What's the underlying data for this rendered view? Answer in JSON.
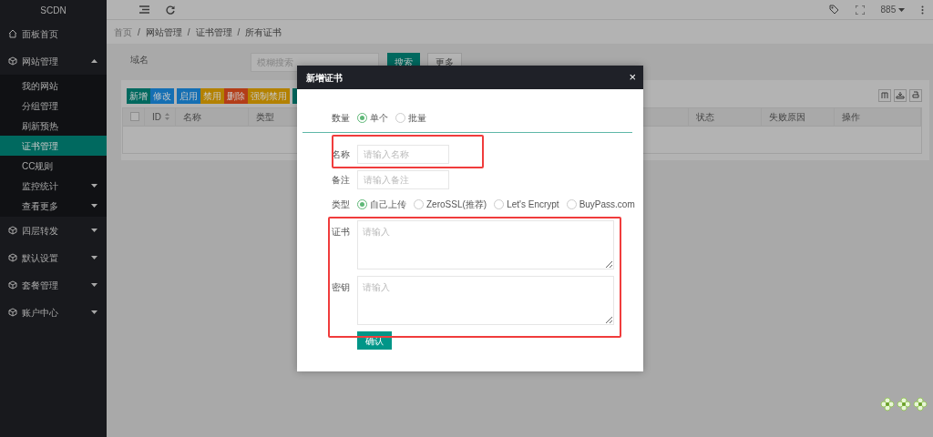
{
  "sidebar": {
    "logo": "SCDN",
    "items": [
      {
        "kind": "home",
        "label": "面板首页"
      },
      {
        "kind": "menu",
        "label": "网站管理",
        "expanded": true,
        "children": [
          {
            "kind": "link",
            "label": "我的网站",
            "selected": false
          },
          {
            "kind": "link",
            "label": "分组管理",
            "selected": false
          },
          {
            "kind": "link",
            "label": "刷新预热",
            "selected": false
          },
          {
            "kind": "link",
            "label": "证书管理",
            "selected": true
          },
          {
            "kind": "link",
            "label": "CC规则",
            "selected": false
          },
          {
            "kind": "menu",
            "label": "监控统计",
            "selected": false,
            "expanded": false
          },
          {
            "kind": "menu",
            "label": "查看更多",
            "selected": false,
            "expanded": false
          }
        ]
      },
      {
        "kind": "menu",
        "label": "四层转发",
        "expanded": false
      },
      {
        "kind": "menu",
        "label": "默认设置",
        "expanded": false
      },
      {
        "kind": "menu",
        "label": "套餐管理",
        "expanded": false
      },
      {
        "kind": "menu",
        "label": "账户中心",
        "expanded": false
      }
    ]
  },
  "header": {
    "user": "885"
  },
  "breadcrumb": {
    "separator": "/",
    "items": [
      "首页",
      "网站管理",
      "证书管理",
      "所有证书"
    ]
  },
  "filter": {
    "label": "域名",
    "placeholder": "模糊搜索",
    "search_button": "搜索",
    "more_button": "更多"
  },
  "toolbar": [
    {
      "buttons": [
        {
          "label": "新增",
          "color": "#00695f"
        },
        {
          "label": "修改",
          "color": "#156fb3"
        }
      ]
    },
    {
      "buttons": [
        {
          "label": "启用",
          "color": "#156fb3"
        },
        {
          "label": "禁用",
          "color": "#b38100"
        },
        {
          "label": "删除",
          "color": "#b33d18"
        },
        {
          "label": "强制禁用",
          "color": "#b38100"
        }
      ]
    },
    {
      "buttons": [
        {
          "color": "#00695f"
        }
      ]
    }
  ],
  "table": {
    "select_all": {
      "checked": false
    },
    "columns": [
      "ID",
      "名称",
      "类型",
      "状态",
      "失败原因",
      "操作"
    ]
  },
  "modal": {
    "title": "新增证书",
    "close": "×",
    "quantity": {
      "label": "数量",
      "options": [
        {
          "label": "单个",
          "selected": true
        },
        {
          "label": "批量",
          "selected": false
        }
      ]
    },
    "name": {
      "label": "名称",
      "placeholder": "请输入名称"
    },
    "note": {
      "label": "备注",
      "placeholder": "请输入备注"
    },
    "type": {
      "label": "类型",
      "options": [
        {
          "label": "自己上传",
          "selected": true
        },
        {
          "label": "ZeroSSL(推荐)",
          "selected": false
        },
        {
          "label": "Let's Encrypt",
          "selected": false
        },
        {
          "label": "BuyPass.com",
          "selected": false
        }
      ]
    },
    "certificate": {
      "label": "证书",
      "placeholder": "请输入"
    },
    "key": {
      "label": "密钥",
      "placeholder": "请输入"
    },
    "submit": "确认"
  }
}
